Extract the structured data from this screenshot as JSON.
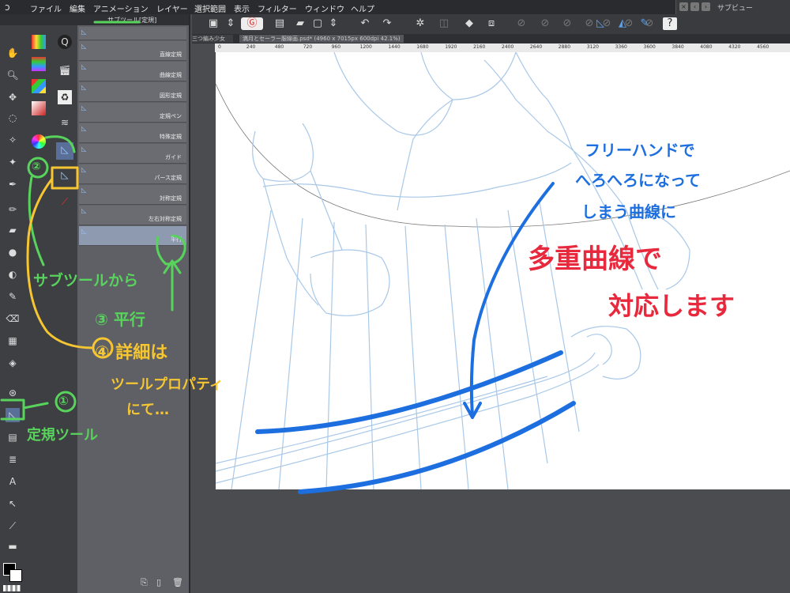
{
  "menu": {
    "app_icon": "clip-studio-icon",
    "items": [
      "ファイル",
      "編集",
      "アニメーション",
      "レイヤー",
      "選択範囲",
      "表示",
      "フィルター",
      "ウィンドウ",
      "ヘルプ"
    ]
  },
  "subview": {
    "label": "サブビュー"
  },
  "subtool_panel": {
    "title": "サブツール[定規]",
    "items": [
      "直線定規",
      "曲線定規",
      "図形定規",
      "定規ペン",
      "特殊定規",
      "ガイド",
      "パース定規",
      "対称定規",
      "左右対称定規",
      "平行"
    ],
    "selected": "平行"
  },
  "document": {
    "tabs": [
      "三つ編み少女",
      "満月とセーラー服線画.psd* (4960 x 7015px 600dpi 42.1%)"
    ],
    "ruler_ticks": [
      "0",
      "240",
      "480",
      "720",
      "960",
      "1200",
      "1440",
      "1680",
      "1920",
      "2160",
      "2400",
      "2640",
      "2880",
      "3120",
      "3360",
      "3600",
      "3840",
      "4080",
      "4320",
      "4560"
    ]
  },
  "annotations": {
    "step1": "①",
    "step1_label": "定規ツール",
    "step2": "②",
    "step2_label": "サブツールから",
    "step3": "③ 平行",
    "step4": "④ 詳細は",
    "step4_line2": "ツールプロパティ",
    "step4_line3": "にて…",
    "blue_line1": "フリーハンドで",
    "blue_line2": "へろへろになって",
    "blue_line3": "しまう曲線に",
    "red_line1": "多重曲線で",
    "red_line2": "対応します"
  },
  "colors": {
    "annot_green": "#58d35c",
    "annot_yellow": "#f5c632",
    "annot_blue": "#1d6fe0",
    "annot_red": "#e8283c",
    "lineart": "#a9c8e8"
  }
}
